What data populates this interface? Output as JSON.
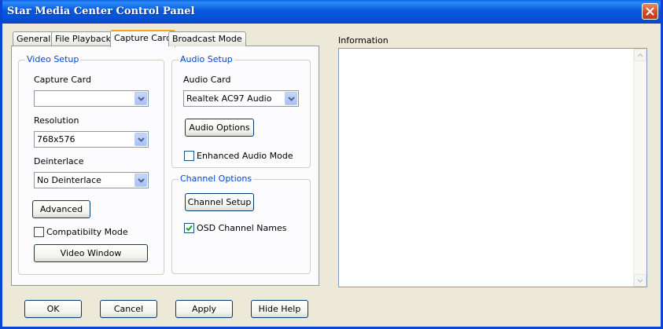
{
  "window": {
    "title": "Star Media Center Control Panel"
  },
  "tabs": [
    {
      "label": "General",
      "active": false
    },
    {
      "label": "File Playback",
      "active": false
    },
    {
      "label": "Capture Card",
      "active": true
    },
    {
      "label": "Broadcast Mode",
      "active": false
    }
  ],
  "video_setup": {
    "legend": "Video Setup",
    "capture_card_label": "Capture Card",
    "capture_card_value": "",
    "resolution_label": "Resolution",
    "resolution_value": "768x576",
    "deinterlace_label": "Deinterlace",
    "deinterlace_value": "No Deinterlace",
    "advanced_button": "Advanced",
    "compatibility_label": "Compatibilty Mode",
    "compatibility_checked": false,
    "video_window_button": "Video Window"
  },
  "audio_setup": {
    "legend": "Audio Setup",
    "audio_card_label": "Audio Card",
    "audio_card_value": "Realtek AC97 Audio",
    "audio_options_button": "Audio Options",
    "enhanced_label": "Enhanced Audio Mode",
    "enhanced_checked": false
  },
  "channel_options": {
    "legend": "Channel Options",
    "channel_setup_button": "Channel Setup",
    "osd_label": "OSD Channel Names",
    "osd_checked": true
  },
  "information": {
    "label": "Information",
    "content": ""
  },
  "footer": {
    "ok": "OK",
    "cancel": "Cancel",
    "apply": "Apply",
    "hide_help": "Hide Help"
  },
  "icons": {
    "close": "close-icon",
    "dropdown": "chevron-down-icon",
    "check": "checkmark-icon"
  },
  "colors": {
    "titlebar": "#0a58df",
    "group_legend": "#0046d5",
    "close_button": "#d54a25",
    "window_bg": "#ece9d8",
    "checkmark": "#21a121"
  }
}
